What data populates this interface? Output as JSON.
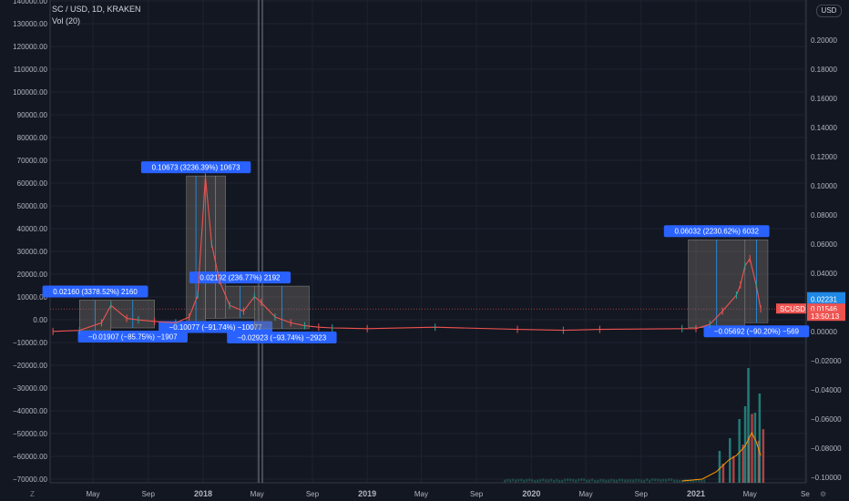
{
  "header": {
    "symbol_line": "SC / USD, 1D, KRAKEN",
    "indicator": "Vol (20)",
    "currency_button": "USD"
  },
  "controls": {
    "zoom_reset": "Z",
    "settings": "⚙"
  },
  "colors": {
    "background": "#131722",
    "grid": "#1f2330",
    "up": "#26a69a",
    "down": "#ef5350",
    "measure_box": "#6e6b66",
    "measure_label": "#2962ff",
    "price_tag": "#ef5350",
    "level_tag": "#1e88e5",
    "vol_ma": "#ff9800"
  },
  "chart_data": {
    "type": "line",
    "title": "SC / USD, 1D, KRAKEN",
    "x_ticks": [
      "May",
      "Sep",
      "2018",
      "May",
      "Sep",
      "2019",
      "May",
      "Sep",
      "2020",
      "May",
      "Sep",
      "2021",
      "May",
      "Se"
    ],
    "left_axis": {
      "ticks": [
        140000,
        130000,
        120000,
        110000,
        100000,
        90000,
        80000,
        70000,
        60000,
        50000,
        40000,
        30000,
        20000,
        10000,
        0,
        -10000,
        -20000,
        -30000,
        -40000,
        -50000,
        -60000,
        -70000
      ],
      "tick_labels": [
        "140000.00",
        "130000.00",
        "120000.00",
        "110000.00",
        "100000.00",
        "90000.00",
        "80000.00",
        "70000.00",
        "60000.00",
        "50000.00",
        "40000.00",
        "30000.00",
        "20000.00",
        "10000.00",
        "0.00",
        "−10000.00",
        "−20000.00",
        "−30000.00",
        "−40000.00",
        "−50000.00",
        "−60000.00",
        "−70000.00"
      ]
    },
    "right_axis": {
      "ticks": [
        0.2,
        0.18,
        0.16,
        0.14,
        0.12,
        0.1,
        0.08,
        0.06,
        0.04,
        0.02,
        0,
        -0.02,
        -0.04,
        -0.06,
        -0.08,
        -0.1
      ],
      "tick_labels": [
        "0.20000",
        "0.18000",
        "0.16000",
        "0.14000",
        "0.12000",
        "0.10000",
        "0.08000",
        "0.06000",
        "0.04000",
        "0.02000",
        "0.00000",
        "−0.02000",
        "−0.04000",
        "−0.06000",
        "−0.08000",
        "−0.10000"
      ],
      "price_labels": [
        {
          "text": "0.02231",
          "value": 0.0233,
          "kind": "level"
        },
        {
          "text": "0.02231",
          "value": 0.0223,
          "kind": "level"
        },
        {
          "text": "0.01546",
          "value": 0.0155,
          "kind": "price"
        },
        {
          "text": "13:50:13",
          "value": 0.0105,
          "kind": "timer"
        }
      ],
      "symbol_tag": "SCUSD"
    },
    "series": [
      {
        "x": [
          "2017-02-01",
          "2017-04-01",
          "2017-05-20",
          "2017-06-10",
          "2017-07-15",
          "2017-08-10",
          "2017-09-15",
          "2017-11-01",
          "2017-12-01",
          "2017-12-20",
          "2018-01-06",
          "2018-01-20",
          "2018-02-06",
          "2018-03-01",
          "2018-04-01",
          "2018-04-25",
          "2018-05-10",
          "2018-06-10",
          "2018-07-15",
          "2018-08-15",
          "2018-09-15",
          "2018-10-15",
          "2019-01-01",
          "2019-06-01",
          "2019-12-01",
          "2020-03-12",
          "2020-06-01",
          "2020-12-01",
          "2021-01-01",
          "2021-02-01",
          "2021-03-01",
          "2021-04-01",
          "2021-04-10",
          "2021-04-20",
          "2021-05-01",
          "2021-05-15",
          "2021-05-25"
        ],
        "values": [
          0.0001,
          0.0008,
          0.006,
          0.018,
          0.009,
          0.008,
          0.007,
          0.006,
          0.01,
          0.025,
          0.106,
          0.06,
          0.035,
          0.018,
          0.014,
          0.024,
          0.02,
          0.01,
          0.006,
          0.004,
          0.003,
          0.0025,
          0.002,
          0.003,
          0.0015,
          0.0009,
          0.0015,
          0.002,
          0.002,
          0.005,
          0.014,
          0.025,
          0.032,
          0.045,
          0.05,
          0.032,
          0.0155
        ]
      }
    ],
    "measurements": [
      {
        "label": "0.02160 (3378.52%) 2160",
        "x0": "2017-04-01",
        "x1": "2017-06-10",
        "y0": 0.0006,
        "y1": 0.0216
      },
      {
        "label": "−0.01907 (−85.75%) −1907",
        "x0": "2017-06-10",
        "x1": "2017-09-15",
        "y0": 0.0216,
        "y1": 0.0025
      },
      {
        "label": "0.10673 (3236.39%) 10673",
        "x0": "2017-11-25",
        "x1": "2018-01-06",
        "y0": 0.0033,
        "y1": 0.1068
      },
      {
        "label": "−0.10077 (−91.74%) −10077",
        "x0": "2018-01-06",
        "x1": "2018-02-20",
        "y0": 0.1068,
        "y1": 0.0091
      },
      {
        "label": "0.02192 (236.77%) 2192",
        "x0": "2018-02-20",
        "x1": "2018-04-25",
        "y0": 0.0093,
        "y1": 0.0312
      },
      {
        "label": "−0.02923 (−93.74%) −2923",
        "x0": "2018-04-25",
        "x1": "2018-08-25",
        "y0": 0.0312,
        "y1": 0.0019
      },
      {
        "label": "0.06032 (2230.62%) 6032",
        "x0": "2020-12-15",
        "x1": "2021-04-20",
        "y0": 0.0027,
        "y1": 0.063
      },
      {
        "label": "−0.05692 (−90.20%) −569",
        "x0": "2021-04-20",
        "x1": "2021-06-10",
        "y0": 0.063,
        "y1": 0.0061
      }
    ],
    "volume_spikes": [
      {
        "x": "2021-02-20",
        "v": 0.25
      },
      {
        "x": "2021-03-15",
        "v": 0.35
      },
      {
        "x": "2021-04-05",
        "v": 0.5
      },
      {
        "x": "2021-04-18",
        "v": 0.6
      },
      {
        "x": "2021-04-25",
        "v": 0.9
      },
      {
        "x": "2021-05-10",
        "v": 0.55
      },
      {
        "x": "2021-05-20",
        "v": 0.7
      }
    ],
    "grid": true
  }
}
